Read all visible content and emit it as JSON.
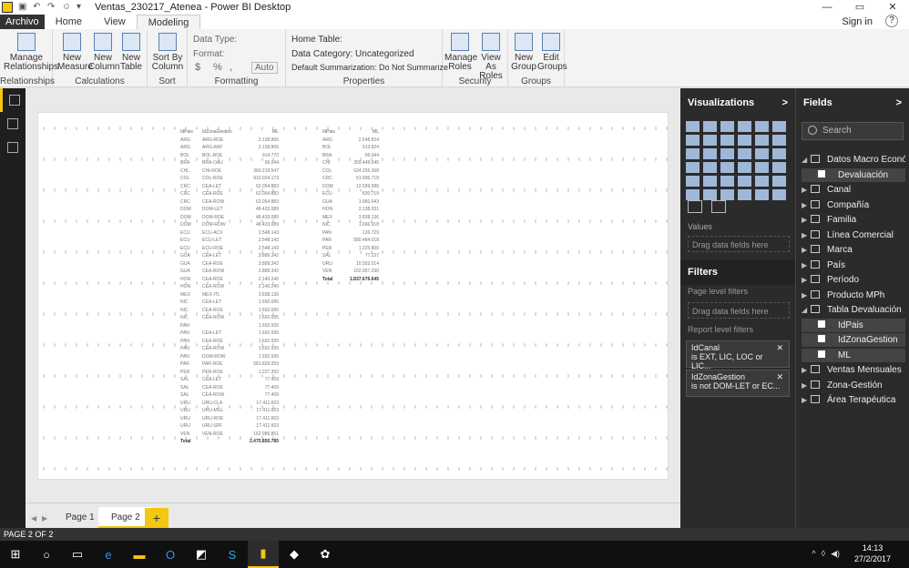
{
  "titlebar": {
    "title": "Ventas_230217_Atenea - Power BI Desktop"
  },
  "menubar": {
    "tabs": [
      "Archivo",
      "Home",
      "View",
      "Modeling"
    ],
    "signin": "Sign in",
    "help": "?"
  },
  "ribbon": {
    "groups": {
      "relationships": {
        "label": "Relationships",
        "btn": "Manage Relationships"
      },
      "calculations": {
        "label": "Calculations",
        "btns": [
          "New Measure",
          "New Column",
          "New Table"
        ]
      },
      "sort": {
        "label": "Sort",
        "btn": "Sort By Column"
      },
      "formatting": {
        "label": "Formatting",
        "data_type": "Data Type:",
        "format": "Format:",
        "currency": "$",
        "percent": "%",
        "comma": ",",
        "auto": "Auto"
      },
      "properties": {
        "label": "Properties",
        "home_table": "Home Table:",
        "data_category": "Data Category: Uncategorized",
        "default_summarization": "Default Summarization: Do Not Summarize"
      },
      "security": {
        "label": "Security",
        "btns": [
          "Manage Roles",
          "View As Roles"
        ]
      },
      "groups": {
        "label": "Groups",
        "btns": [
          "New Group",
          "Edit Groups"
        ]
      }
    }
  },
  "table1": {
    "headers": [
      "IdPais",
      "IdZonaGestion",
      "ML"
    ],
    "rows": [
      [
        "ARG",
        "ARG-ROE",
        "3.138.806"
      ],
      [
        "ARG",
        "ARG-RAY",
        "3.138.806"
      ],
      [
        "BOL",
        "BOL-ROE",
        "914.770"
      ],
      [
        "BRA",
        "BRA-OAU",
        "56.044"
      ],
      [
        "CHL",
        "CHI-ROE",
        "360.219.547"
      ],
      [
        "COL",
        "COL-ROE",
        "910.024.173"
      ],
      [
        "CRC",
        "CEA-LET",
        "62.054.883"
      ],
      [
        "CRC",
        "CEA-ROE",
        "62.054.883"
      ],
      [
        "CRC",
        "CEA-ROW",
        "62.054.883"
      ],
      [
        "DOM",
        "DOM-LET",
        "48.433.089"
      ],
      [
        "DOM",
        "DOM-ROE",
        "48.433.089"
      ],
      [
        "DOM",
        "DOM-ROW",
        "48.433.089"
      ],
      [
        "ECU",
        "ECU-ACX",
        "2.548.143"
      ],
      [
        "ECU",
        "ECU-LET",
        "2.548.143"
      ],
      [
        "ECU",
        "ECU-ROE",
        "2.548.143"
      ],
      [
        "GUA",
        "CEA-LET",
        "3.889.342"
      ],
      [
        "GUA",
        "CEA-ROE",
        "3.889.342"
      ],
      [
        "GUA",
        "CEA-ROW",
        "3.889.342"
      ],
      [
        "HON",
        "CEA-ROE",
        "2.140.240"
      ],
      [
        "HON",
        "CEA-ROW",
        "2.140.240"
      ],
      [
        "MEX",
        "MEX-ITL",
        "3.838.136"
      ],
      [
        "NIC",
        "CEA-LET",
        "1.692.685"
      ],
      [
        "NIC",
        "CEA-ROE",
        "1.692.685"
      ],
      [
        "NIC",
        "CEA-ROW",
        "1.692.685"
      ],
      [
        "PAN",
        "",
        "1.692.935"
      ],
      [
        "PAN",
        "CEA-LET",
        "1.692.935"
      ],
      [
        "PAN",
        "CEA-ROE",
        "1.692.935"
      ],
      [
        "PAN",
        "CEA-ROW",
        "1.692.935"
      ],
      [
        "PAN",
        "DOM-ROW",
        "1.692.935"
      ],
      [
        "PAR",
        "PAR-ROE",
        "581.829.059"
      ],
      [
        "PER",
        "PER-ROE",
        "1.227.392"
      ],
      [
        "SAL",
        "CEA-LET",
        "77.409"
      ],
      [
        "SAL",
        "CEA-ROE",
        "77.409"
      ],
      [
        "SAL",
        "CEA-ROW",
        "77.409"
      ],
      [
        "URU",
        "URU-CLA",
        "17.411.603"
      ],
      [
        "URU",
        "URU-MGL",
        "17.411.603"
      ],
      [
        "URU",
        "URU-ROE",
        "17.411.603"
      ],
      [
        "URU",
        "URU-SPF",
        "17.411.603"
      ],
      [
        "VEN",
        "VEN-ROE",
        "162.985.851"
      ]
    ],
    "total_label": "Total",
    "total_value": "2.475.850.785"
  },
  "table2": {
    "headers": [
      "IdPais",
      "ML"
    ],
    "rows": [
      [
        "ARG",
        "2.548.824"
      ],
      [
        "BOL",
        "913.824"
      ],
      [
        "BRA",
        "56.044"
      ],
      [
        "CHI",
        "359.449.045"
      ],
      [
        "COL",
        "624.255.268"
      ],
      [
        "CRC",
        "61.996.718"
      ],
      [
        "DOM",
        "12.599.586"
      ],
      [
        "ECU",
        "830.719"
      ],
      [
        "GUA",
        "1.960.043"
      ],
      [
        "HON",
        "2.138.031"
      ],
      [
        "MEX",
        "3.838.136"
      ],
      [
        "NIC",
        "1.666.918"
      ],
      [
        "PAN",
        "126.729"
      ],
      [
        "PAR",
        "580.484.018"
      ],
      [
        "PER",
        "1.225.800"
      ],
      [
        "SAL",
        "77.237"
      ],
      [
        "URU",
        "10.552.014"
      ],
      [
        "VEN",
        "162.957.290"
      ]
    ],
    "total_label": "Total",
    "total_value": "1.837.676.645"
  },
  "pages": {
    "tabs": [
      "Page 1",
      "Page 2"
    ],
    "add": "+"
  },
  "status": {
    "text": "PAGE 2 OF 2"
  },
  "visualizations": {
    "title": "Visualizations",
    "arrow": ">",
    "values_label": "Values",
    "drag_values": "Drag data fields here"
  },
  "filters": {
    "title": "Filters",
    "page_level": "Page level filters",
    "drag_page": "Drag data fields here",
    "report_level": "Report level filters",
    "cards": [
      {
        "field": "IdCanal",
        "condition": "is EXT, LIC, LOC or LIC..."
      },
      {
        "field": "IdZonaGestion",
        "condition": "is not DOM-LET or EC..."
      }
    ],
    "close": "✕"
  },
  "fields": {
    "title": "Fields",
    "arrow": ">",
    "search_placeholder": "Search",
    "tables": [
      {
        "name": "Datos Macro Econó...",
        "expanded": true,
        "children": [
          "Devaluación"
        ]
      },
      {
        "name": "Canal"
      },
      {
        "name": "Compañía"
      },
      {
        "name": "Familia"
      },
      {
        "name": "Línea Comercial"
      },
      {
        "name": "Marca"
      },
      {
        "name": "País"
      },
      {
        "name": "Período"
      },
      {
        "name": "Producto MPh"
      },
      {
        "name": "Tabla Devaluación",
        "expanded": true,
        "children": [
          "IdPais",
          "IdZonaGestion",
          "ML"
        ]
      },
      {
        "name": "Ventas Mensuales"
      },
      {
        "name": "Zona-Gestión"
      },
      {
        "name": "Área Terapéutica"
      }
    ]
  },
  "taskbar": {
    "time": "14:13",
    "date": "27/2/2017"
  }
}
